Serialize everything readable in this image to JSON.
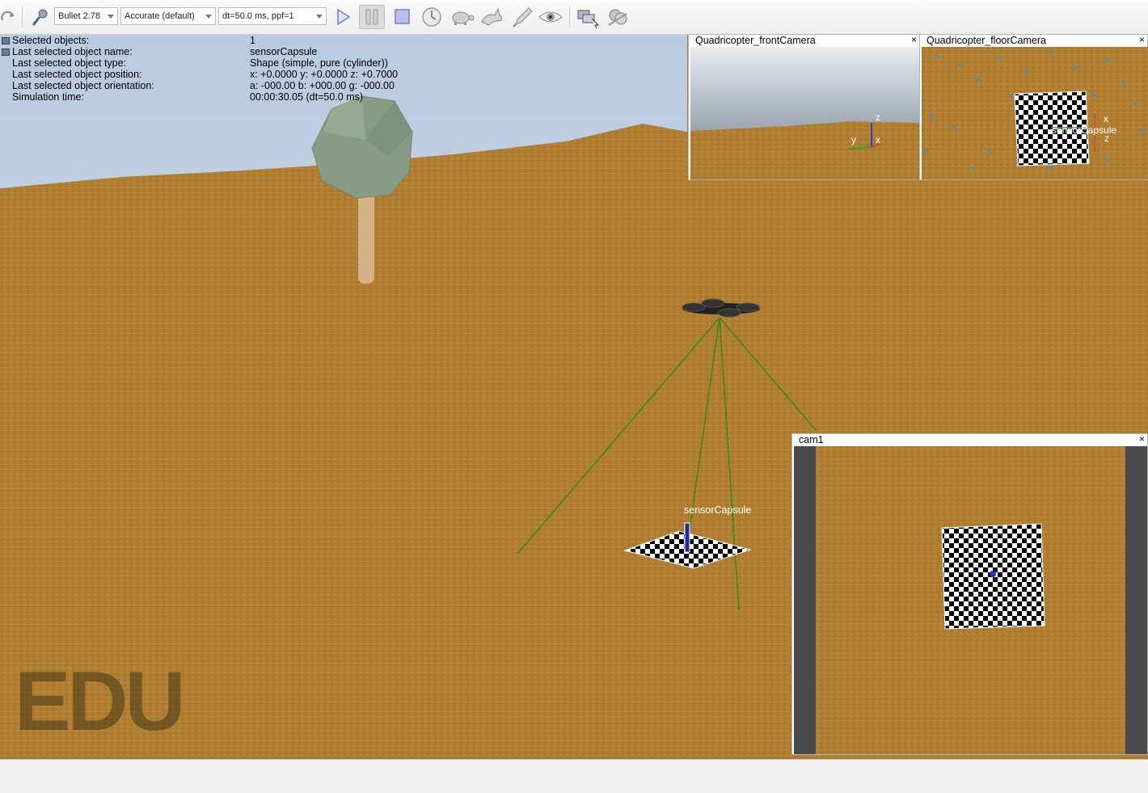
{
  "toolbar": {
    "engine": "Bullet 2.78",
    "accuracy": "Accurate (default)",
    "timestep": "dt=50.0 ms, ppf=1",
    "icons": [
      "redo-icon",
      "select-icon",
      "play-icon",
      "pause-icon",
      "stop-icon",
      "realtime-icon",
      "slow-down-icon",
      "speed-up-icon",
      "threaded-rendering-icon",
      "visualization-icon",
      "scene-selector-icon",
      "model-browser-icon"
    ]
  },
  "info": {
    "rows": [
      {
        "label": "Selected objects:",
        "value": "1"
      },
      {
        "label": "Last selected object name:",
        "value": "sensorCapsule"
      },
      {
        "label": "Last selected object type:",
        "value": "Shape (simple, pure (cylinder))"
      },
      {
        "label": "Last selected object position:",
        "value": "x: +0.0000    y: +0.0000    z: +0.7000"
      },
      {
        "label": "Last selected object orientation:",
        "value": "a: -000.00    b: +000.00    g: -000.00"
      },
      {
        "label": "Simulation time:",
        "value": "00:00:30.05 (dt=50.0 ms)"
      }
    ]
  },
  "scene": {
    "object_label": "sensorCapsule",
    "watermark": "EDU"
  },
  "views": {
    "front": {
      "title": "Quadricopter_frontCamera",
      "close": "×",
      "axes": [
        "z",
        "y",
        "x"
      ]
    },
    "floor": {
      "title": "Quadricopter_floorCamera",
      "close": "×",
      "object_label": "sensorCapsule",
      "axes": [
        "x",
        "z"
      ]
    },
    "cam1": {
      "title": "cam1",
      "close": "×"
    }
  },
  "colors": {
    "ground": "#b07f32",
    "sky": "#c9d6e3",
    "tree_foliage": "#8aa087",
    "tree_trunk": "#d8b889",
    "vision_lines": "#3a8a1e"
  }
}
